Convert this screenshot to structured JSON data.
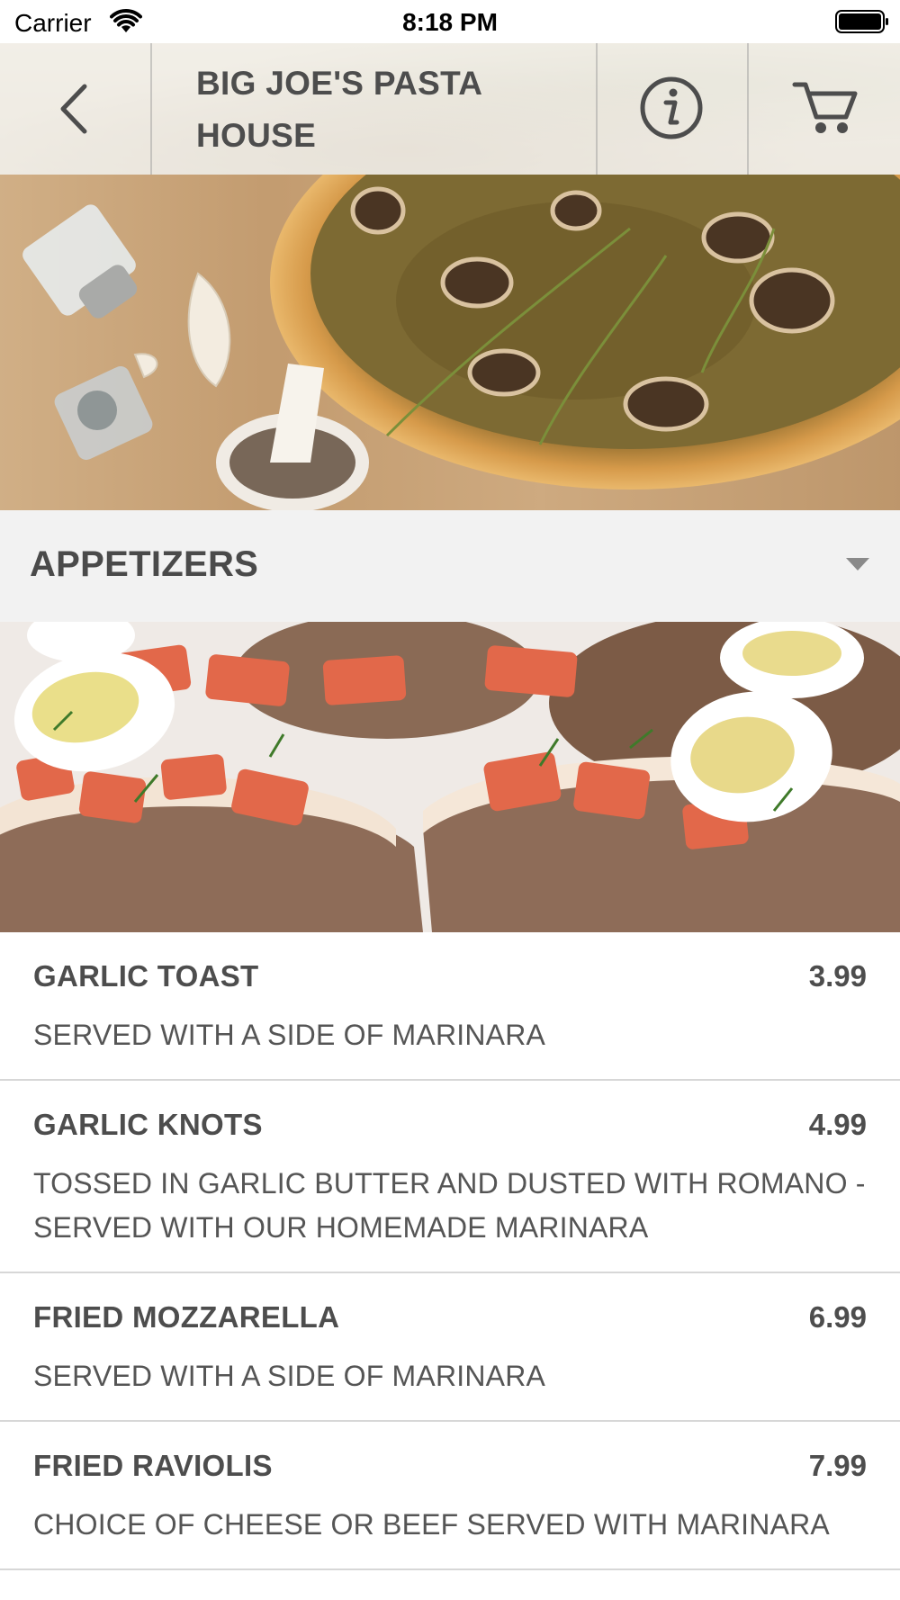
{
  "status_bar": {
    "carrier": "Carrier",
    "time": "8:18 PM"
  },
  "header": {
    "title": "BIG JOE'S PASTA HOUSE",
    "back_icon": "chevron-left-icon",
    "info_icon": "info-icon",
    "cart_icon": "cart-icon"
  },
  "category": {
    "title": "APPETIZERS",
    "toggle_icon": "chevron-down-icon"
  },
  "menu_items": [
    {
      "name": "GARLIC TOAST",
      "price": "3.99",
      "description": "SERVED WITH A SIDE OF MARINARA"
    },
    {
      "name": "GARLIC KNOTS",
      "price": "4.99",
      "description": "TOSSED IN GARLIC BUTTER AND DUSTED WITH ROMANO - SERVED WITH OUR HOMEMADE MARINARA"
    },
    {
      "name": "FRIED MOZZARELLA",
      "price": "6.99",
      "description": "SERVED WITH A SIDE OF MARINARA"
    },
    {
      "name": "FRIED RAVIOLIS",
      "price": "7.99",
      "description": "CHOICE OF CHEESE OR BEEF SERVED WITH MARINARA"
    }
  ],
  "colors": {
    "header_text": "#4d4d4d",
    "category_bg": "#f2f2f2",
    "divider": "#d7d7d7"
  }
}
